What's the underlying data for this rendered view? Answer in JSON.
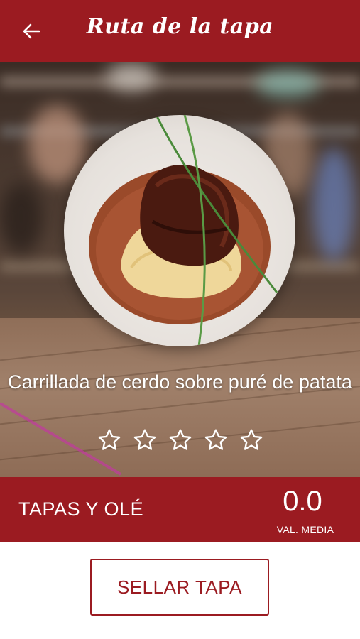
{
  "header": {
    "title": "Ruta de la tapa",
    "back_icon": "arrow-left-icon"
  },
  "hero": {
    "dish_name": "Carrillada de cerdo sobre puré de patata",
    "rating_stars": {
      "filled": 0,
      "total": 5,
      "icon": "star-outline-icon"
    }
  },
  "info_bar": {
    "establishment": "TAPAS Y OLÉ",
    "average_value": "0.0",
    "average_label": "VAL. MEDIA"
  },
  "actions": {
    "stamp_label": "SELLAR TAPA"
  },
  "colors": {
    "brand": "#9b1b21",
    "text_on_brand": "#ffffff",
    "background": "#ffffff"
  }
}
